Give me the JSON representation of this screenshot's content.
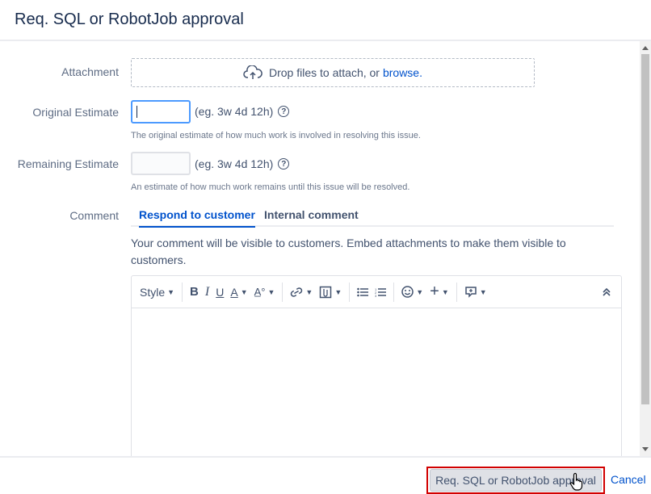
{
  "dialog": {
    "title": "Req. SQL or RobotJob approval"
  },
  "form": {
    "attachment": {
      "label": "Attachment",
      "drop_text": "Drop files to attach, or",
      "browse_link": "browse."
    },
    "original_estimate": {
      "label": "Original Estimate",
      "value": "",
      "example": "(eg. 3w 4d 12h)",
      "description": "The original estimate of how much work is involved in resolving this issue."
    },
    "remaining_estimate": {
      "label": "Remaining Estimate",
      "value": "",
      "example": "(eg. 3w 4d 12h)",
      "description": "An estimate of how much work remains until this issue will be resolved."
    },
    "comment": {
      "label": "Comment",
      "tabs": [
        {
          "label": "Respond to customer",
          "active": true
        },
        {
          "label": "Internal comment",
          "active": false
        }
      ],
      "note": "Your comment will be visible to customers. Embed attachments to make them visible to customers.",
      "toolbar": {
        "style_label": "Style",
        "icons": [
          "bold-icon",
          "italic-icon",
          "underline-icon",
          "text-color-icon",
          "text-format-icon",
          "link-icon",
          "attachment-icon",
          "bullet-list-icon",
          "numbered-list-icon",
          "emoji-icon",
          "insert-icon",
          "macro-icon",
          "collapse-icon"
        ]
      },
      "value": ""
    }
  },
  "footer": {
    "submit_label": "Req. SQL or RobotJob approval",
    "cancel_label": "Cancel"
  },
  "colors": {
    "link": "#0052cc",
    "highlight_box": "#d10000",
    "label": "#5e6c84"
  }
}
